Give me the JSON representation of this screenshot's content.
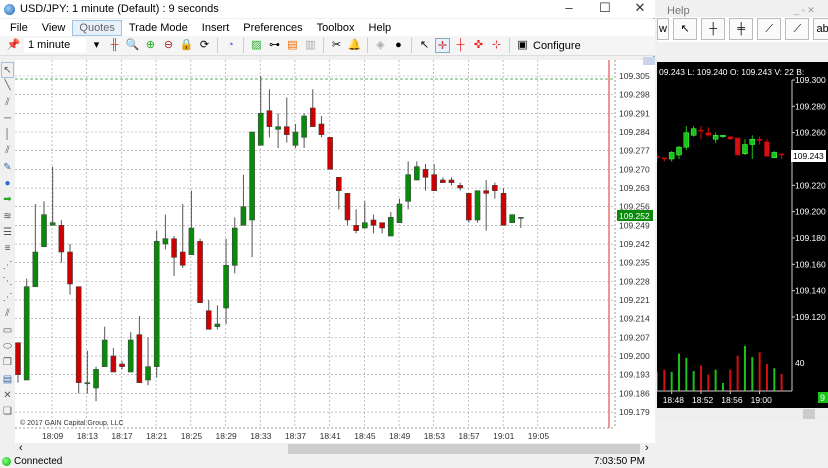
{
  "window": {
    "title": "USD/JPY: 1 minute (Default) : 9 seconds",
    "minimize": "–",
    "maximize": "☐",
    "close": "✕"
  },
  "menu": [
    "File",
    "View",
    "Quotes",
    "Trade Mode",
    "Insert",
    "Preferences",
    "Toolbox",
    "Help"
  ],
  "toolbar": {
    "timeframe": "1 minute",
    "configure": "Configure"
  },
  "chart": {
    "copyright": "© 2017 GAIN Capital Group, LLC",
    "price_labels": [
      "109.305",
      "109.298",
      "109.291",
      "109.284",
      "109.277",
      "109.270",
      "109.263",
      "109.256",
      "109.249",
      "109.242",
      "109.235",
      "109.228",
      "109.221",
      "109.214",
      "109.207",
      "109.200",
      "109.193",
      "109.186",
      "109.179"
    ],
    "time_labels": [
      "18:09",
      "18:13",
      "18:17",
      "18:21",
      "18:25",
      "18:29",
      "18:33",
      "18:37",
      "18:41",
      "18:45",
      "18:49",
      "18:53",
      "18:57",
      "19:01",
      "19:05"
    ],
    "current_price": "109.252",
    "colors": {
      "up": "#0a8a0a",
      "down": "#cc0000",
      "current_label": "#0a8a0a",
      "vline": "#e03030"
    }
  },
  "chart_data": {
    "type": "candlestick",
    "symbol": "USD/JPY",
    "interval": "1 minute",
    "first_time": "18:05",
    "last_time": "19:03",
    "ylim": [
      109.179,
      109.305
    ],
    "ohlc": [
      [
        109.205,
        109.205,
        109.19,
        109.193
      ],
      [
        109.191,
        109.229,
        109.191,
        109.226
      ],
      [
        109.226,
        109.257,
        109.226,
        109.239
      ],
      [
        109.241,
        109.258,
        109.241,
        109.253
      ],
      [
        109.249,
        109.271,
        109.249,
        109.25
      ],
      [
        109.249,
        109.251,
        109.235,
        109.239
      ],
      [
        109.239,
        109.242,
        109.223,
        109.227
      ],
      [
        109.226,
        109.226,
        109.186,
        109.19
      ],
      [
        109.19,
        109.202,
        109.186,
        109.19
      ],
      [
        109.188,
        109.196,
        109.183,
        109.195
      ],
      [
        109.196,
        109.211,
        109.196,
        109.206
      ],
      [
        109.2,
        109.203,
        109.194,
        109.194
      ],
      [
        109.197,
        109.198,
        109.195,
        109.196
      ],
      [
        109.194,
        109.209,
        109.194,
        109.206
      ],
      [
        109.208,
        109.215,
        109.19,
        109.19
      ],
      [
        109.191,
        109.207,
        109.189,
        109.196
      ],
      [
        109.196,
        109.247,
        109.192,
        109.243
      ],
      [
        109.242,
        109.253,
        109.24,
        109.244
      ],
      [
        109.244,
        109.245,
        109.23,
        109.237
      ],
      [
        109.239,
        109.257,
        109.233,
        109.234
      ],
      [
        109.238,
        109.262,
        109.238,
        109.248
      ],
      [
        109.243,
        109.244,
        109.22,
        109.22
      ],
      [
        109.217,
        109.221,
        109.21,
        109.21
      ],
      [
        109.211,
        109.219,
        109.21,
        109.212
      ],
      [
        109.218,
        109.244,
        109.212,
        109.234
      ],
      [
        109.234,
        109.252,
        109.231,
        109.248
      ],
      [
        109.249,
        109.268,
        109.249,
        109.256
      ],
      [
        109.251,
        109.284,
        109.237,
        109.284
      ],
      [
        109.279,
        109.305,
        109.279,
        109.291
      ],
      [
        109.292,
        109.3,
        109.282,
        109.286
      ],
      [
        109.285,
        109.291,
        109.278,
        109.286
      ],
      [
        109.286,
        109.297,
        109.28,
        109.283
      ],
      [
        109.279,
        109.287,
        109.278,
        109.284
      ],
      [
        109.282,
        109.291,
        109.278,
        109.29
      ],
      [
        109.293,
        109.3,
        109.286,
        109.286
      ],
      [
        109.287,
        109.29,
        109.282,
        109.283
      ],
      [
        109.282,
        109.282,
        109.27,
        109.27
      ],
      [
        109.267,
        109.267,
        109.255,
        109.262
      ],
      [
        109.261,
        109.261,
        109.249,
        109.251
      ],
      [
        109.249,
        109.255,
        109.246,
        109.247
      ],
      [
        109.248,
        109.258,
        109.248,
        109.25
      ],
      [
        109.251,
        109.253,
        109.246,
        109.249
      ],
      [
        109.25,
        109.25,
        109.246,
        109.248
      ],
      [
        109.245,
        109.254,
        109.245,
        109.252
      ],
      [
        109.25,
        109.259,
        109.25,
        109.257
      ],
      [
        109.258,
        109.273,
        109.255,
        109.268
      ],
      [
        109.266,
        109.273,
        109.266,
        109.271
      ],
      [
        109.27,
        109.272,
        109.262,
        109.267
      ],
      [
        109.268,
        109.272,
        109.262,
        109.262
      ],
      [
        109.266,
        109.267,
        109.265,
        109.265
      ],
      [
        109.266,
        109.267,
        109.264,
        109.265
      ],
      [
        109.264,
        109.265,
        109.262,
        109.263
      ],
      [
        109.261,
        109.261,
        109.25,
        109.251
      ],
      [
        109.251,
        109.262,
        109.25,
        109.262
      ],
      [
        109.262,
        109.266,
        109.247,
        109.261
      ],
      [
        109.264,
        109.265,
        109.259,
        109.262
      ],
      [
        109.261,
        109.263,
        109.249,
        109.249
      ],
      [
        109.25,
        109.253,
        109.25,
        109.253
      ],
      [
        109.252,
        109.252,
        109.248,
        109.252
      ]
    ]
  },
  "side": {
    "menu_help": "Help",
    "tools": [
      {
        "icon": "pointer-icon",
        "label": "↖"
      },
      {
        "icon": "crosshair-icon",
        "label": "┼"
      },
      {
        "icon": "vertical-crosshair-icon",
        "label": "╪"
      },
      {
        "icon": "trendline-icon",
        "label": "⟋"
      },
      {
        "icon": "ray-icon",
        "label": "⟋"
      },
      {
        "icon": "text-tool-icon",
        "label": "abc"
      },
      {
        "icon": "rectangle-icon",
        "label": "▭"
      }
    ],
    "info": "09.243 L: 109.240 O: 109.243 V: 22 B:",
    "price_labels": [
      "109.300",
      "109.280",
      "109.260",
      "109.240",
      "109.220",
      "109.200",
      "109.180",
      "109.160",
      "109.140",
      "109.120"
    ],
    "current_price": "109.243",
    "volume_label": "40",
    "time_labels": [
      "18:48",
      "18:52",
      "18:56",
      "19:00"
    ],
    "badge": "9",
    "chart_data": {
      "type": "candlestick",
      "ylim": [
        109.11,
        109.305
      ],
      "ohlc": [
        [
          109.242,
          109.244,
          109.238,
          109.241
        ],
        [
          109.241,
          109.241,
          109.238,
          109.24
        ],
        [
          109.24,
          109.246,
          109.238,
          109.245
        ],
        [
          109.243,
          109.25,
          109.24,
          109.249
        ],
        [
          109.249,
          109.265,
          109.247,
          109.26
        ],
        [
          109.258,
          109.265,
          109.257,
          109.263
        ],
        [
          109.262,
          109.265,
          109.255,
          109.261
        ],
        [
          109.26,
          109.264,
          109.257,
          109.258
        ],
        [
          109.255,
          109.26,
          109.252,
          109.258
        ],
        [
          109.257,
          109.258,
          109.256,
          109.258
        ],
        [
          109.257,
          109.257,
          109.255,
          109.255
        ],
        [
          109.256,
          109.256,
          109.243,
          109.243
        ],
        [
          109.244,
          109.255,
          109.243,
          109.251
        ],
        [
          109.251,
          109.258,
          109.24,
          109.255
        ],
        [
          109.255,
          109.257,
          109.251,
          109.254
        ],
        [
          109.253,
          109.255,
          109.242,
          109.242
        ],
        [
          109.241,
          109.246,
          109.241,
          109.245
        ],
        [
          109.244,
          109.244,
          109.24,
          109.243
        ]
      ],
      "volume": [
        27,
        30,
        27,
        53,
        47,
        28,
        36,
        23,
        30,
        11,
        30,
        50,
        64,
        48,
        55,
        38,
        32,
        24
      ]
    }
  },
  "status": {
    "connection": "Connected",
    "time": "7:03:50 PM"
  }
}
